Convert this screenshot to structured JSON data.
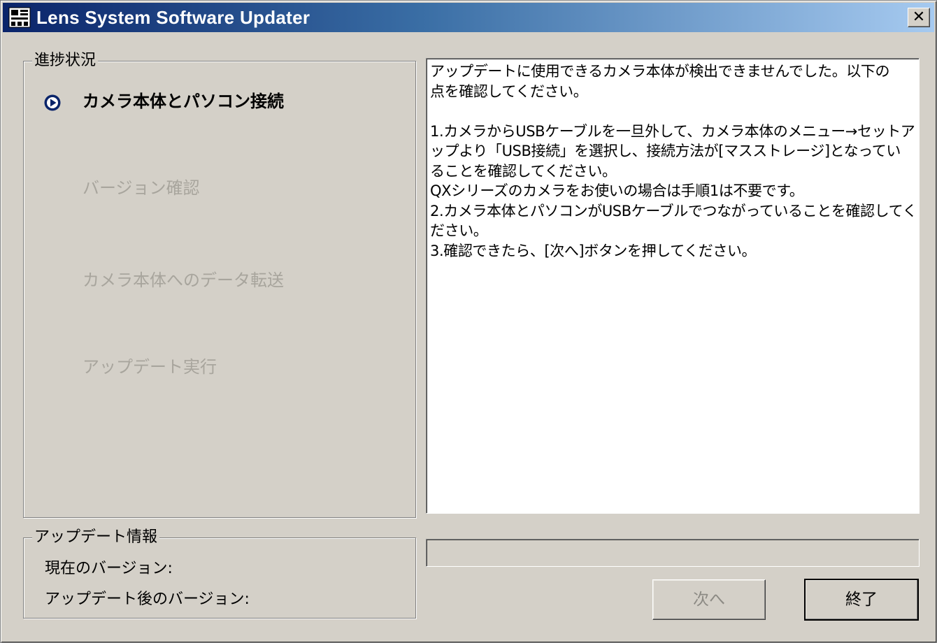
{
  "window": {
    "title": "Lens System Software Updater",
    "close_glyph": "✕",
    "icon_name": "updater-app-icon"
  },
  "progress_panel": {
    "legend": "進捗状況",
    "steps": [
      {
        "label": "カメラ本体とパソコン接続",
        "state": "active"
      },
      {
        "label": "バージョン確認",
        "state": "pending"
      },
      {
        "label": "カメラ本体へのデータ転送",
        "state": "pending"
      },
      {
        "label": "アップデート実行",
        "state": "pending"
      }
    ],
    "active_icon": "play-circle-icon"
  },
  "info_panel": {
    "legend": "アップデート情報",
    "current_version_label": "現在のバージョン:",
    "updated_version_label": "アップデート後のバージョン:"
  },
  "message": {
    "lines": [
      "アップデートに使用できるカメラ本体が検出できませんでした。以下の",
      "点を確認してください。",
      "",
      "1.カメラからUSBケーブルを一旦外して、カメラ本体のメニュー→セットア",
      "ップより「USB接続」を選択し、接続方法が[マスストレージ]となってい",
      "ることを確認してください。",
      "QXシリーズのカメラをお使いの場合は手順1は不要です。",
      "2.カメラ本体とパソコンがUSBケーブルでつながっていることを確認してく",
      "ださい。",
      "3.確認できたら、[次へ]ボタンを押してください。"
    ]
  },
  "progress": {
    "fraction": 0
  },
  "buttons": {
    "next_label": "次へ",
    "exit_label": "終了"
  },
  "colors": {
    "face": "#d4d0c8",
    "title_gradient_start": "#0a246a",
    "title_gradient_end": "#a6caf0",
    "disabled_text": "#a8a59d",
    "active_icon": "#0a246a"
  }
}
